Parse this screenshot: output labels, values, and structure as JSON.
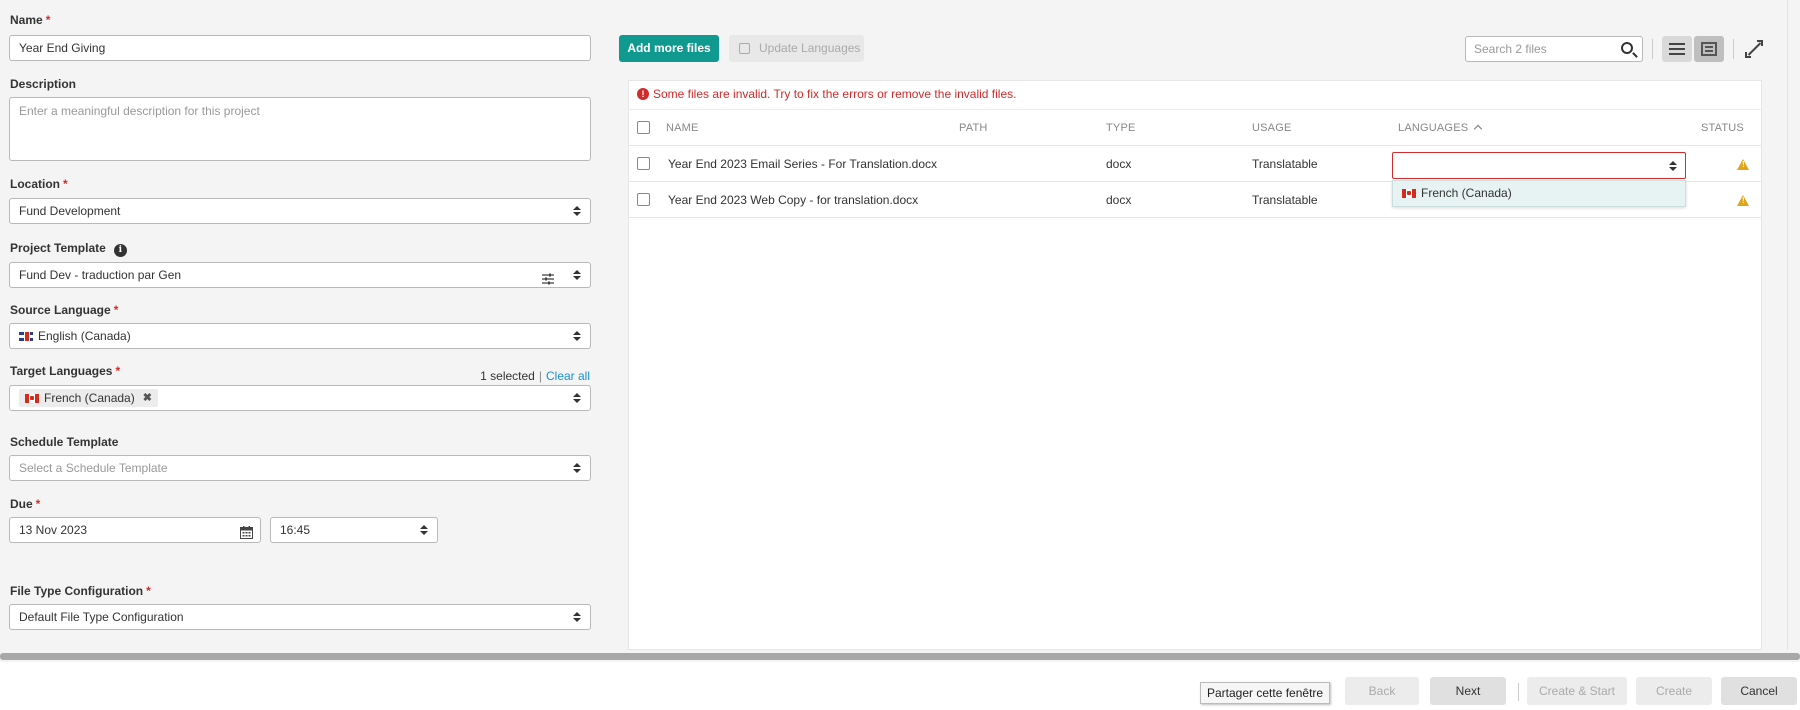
{
  "form": {
    "name": {
      "label": "Name",
      "required_mark": "*",
      "value": "Year End Giving"
    },
    "description": {
      "label": "Description",
      "placeholder": "Enter a meaningful description for this project"
    },
    "location": {
      "label": "Location",
      "required_mark": "*",
      "value": "Fund Development"
    },
    "project_template": {
      "label": "Project Template",
      "value": "Fund Dev - traduction par Gen"
    },
    "source_language": {
      "label": "Source Language",
      "required_mark": "*",
      "value": "English (Canada)"
    },
    "target_languages": {
      "label": "Target Languages",
      "required_mark": "*",
      "selected_count": "1 selected",
      "separator": "|",
      "clear_all": "Clear all",
      "chips": [
        "French (Canada)"
      ]
    },
    "schedule_template": {
      "label": "Schedule Template",
      "placeholder": "Select a Schedule Template"
    },
    "due": {
      "label": "Due",
      "required_mark": "*",
      "date": "13 Nov 2023",
      "time": "16:45"
    },
    "file_type_configuration": {
      "label": "File Type Configuration",
      "required_mark": "*",
      "value": "Default File Type Configuration"
    }
  },
  "toolbar": {
    "add_files": "Add more files",
    "update_languages": "Update Languages",
    "search_placeholder": "Search 2 files"
  },
  "files": {
    "error_message": "Some files are invalid. Try to fix the errors or remove the invalid files.",
    "columns": [
      "NAME",
      "PATH",
      "TYPE",
      "USAGE",
      "LANGUAGES",
      "STATUS"
    ],
    "rows": [
      {
        "name": "Year End 2023 Email Series - For Translation.docx",
        "path": "",
        "type": "docx",
        "usage": "Translatable",
        "languages": ""
      },
      {
        "name": "Year End 2023 Web Copy - for translation.docx",
        "path": "",
        "type": "docx",
        "usage": "Translatable",
        "languages": ""
      }
    ],
    "language_dropdown_option": "French (Canada)"
  },
  "footer": {
    "tooltip": "Partager cette fenêtre",
    "back": "Back",
    "next": "Next",
    "create_start": "Create & Start",
    "create": "Create",
    "cancel": "Cancel"
  },
  "colors": {
    "accent": "#109a8f",
    "error": "#d12b2b",
    "warning": "#e2a417",
    "link": "#1a8fc8"
  },
  "icons": [
    "info-icon",
    "calendar-icon",
    "search-icon",
    "list-view-icon",
    "grid-view-icon",
    "expand-icon",
    "error-icon",
    "warning-icon",
    "sort-up-icon",
    "template-settings-icon",
    "remove-chip-icon"
  ]
}
